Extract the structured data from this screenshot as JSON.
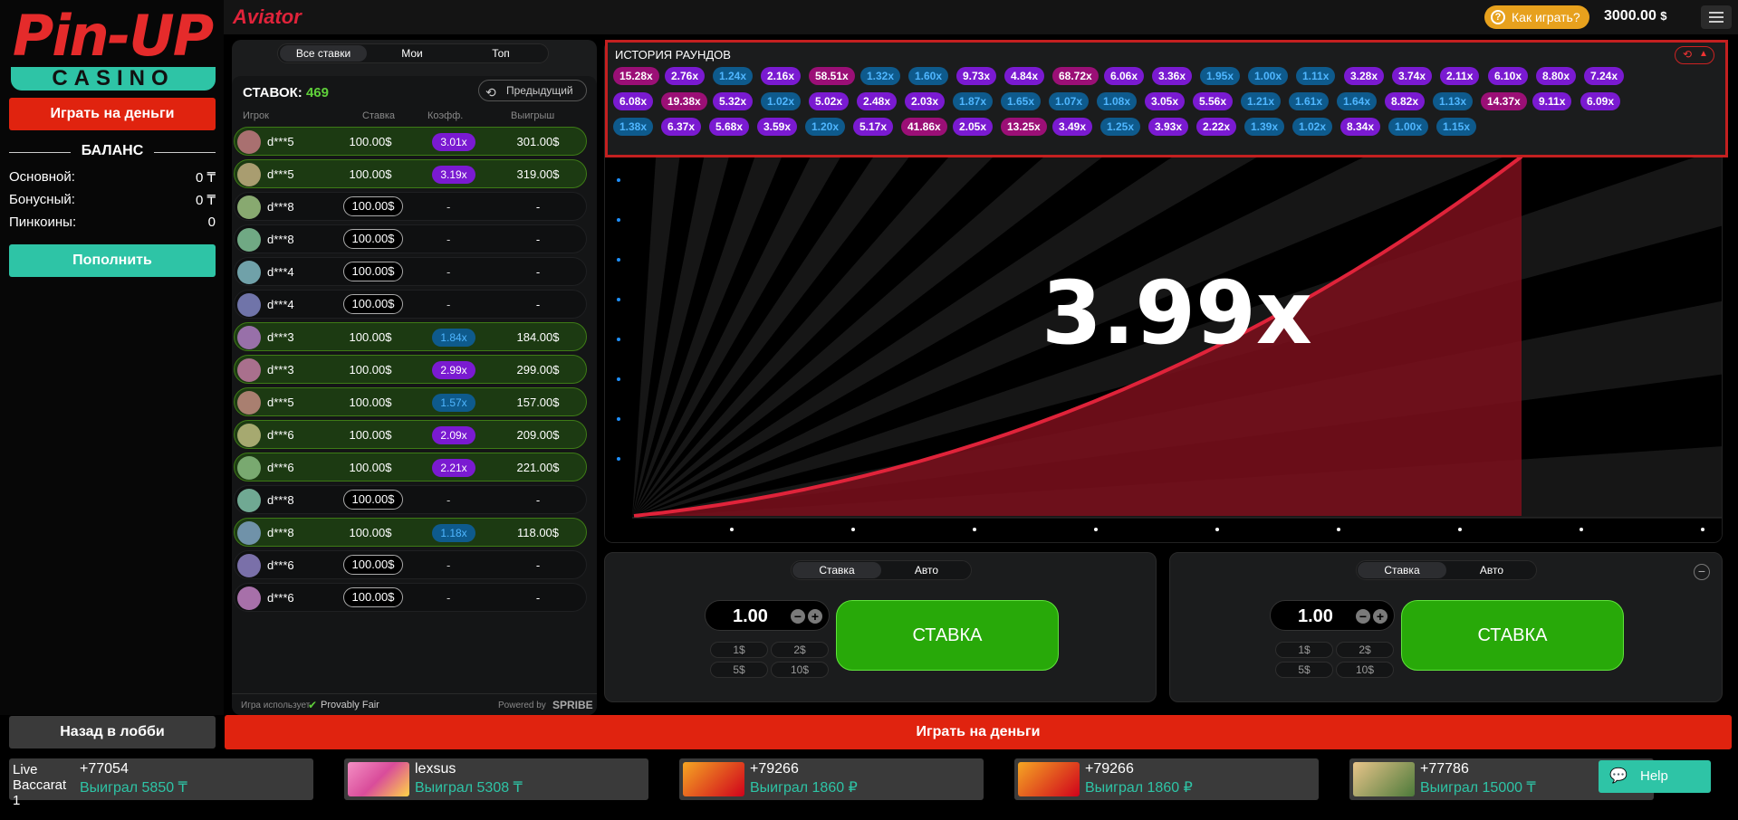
{
  "sidebar": {
    "logo_top": "Pin-UP",
    "logo_bottom": "CASINO",
    "play_money_label": "Играть на деньги",
    "balance_title": "БАЛАНС",
    "balances": [
      {
        "label": "Основной:",
        "value": "0 ₸"
      },
      {
        "label": "Бонусный:",
        "value": "0 ₸"
      },
      {
        "label": "Пинкоины:",
        "value": "0"
      }
    ],
    "deposit_label": "Пополнить",
    "lobby_label": "Назад в лобби"
  },
  "header": {
    "game_title": "Aviator",
    "how_to_label": "Как играть?",
    "balance": "3000.00",
    "currency": "$"
  },
  "bets": {
    "tabs": [
      "Все ставки",
      "Мои",
      "Топ"
    ],
    "count_label": "СТАВОК:",
    "count": "469",
    "prev_label": "Предыдущий",
    "columns": [
      "Игрок",
      "Ставка",
      "Коэфф.",
      "Выигрыш"
    ],
    "rows": [
      {
        "user": "d***5",
        "stake": "100.00$",
        "coef": "3.01x",
        "coef_color": "purp",
        "payout": "301.00$",
        "win": true
      },
      {
        "user": "d***5",
        "stake": "100.00$",
        "coef": "3.19x",
        "coef_color": "purp",
        "payout": "319.00$",
        "win": true
      },
      {
        "user": "d***8",
        "stake": "100.00$",
        "coef": "-",
        "coef_color": "",
        "payout": "-",
        "win": false
      },
      {
        "user": "d***8",
        "stake": "100.00$",
        "coef": "-",
        "coef_color": "",
        "payout": "-",
        "win": false
      },
      {
        "user": "d***4",
        "stake": "100.00$",
        "coef": "-",
        "coef_color": "",
        "payout": "-",
        "win": false
      },
      {
        "user": "d***4",
        "stake": "100.00$",
        "coef": "-",
        "coef_color": "",
        "payout": "-",
        "win": false
      },
      {
        "user": "d***3",
        "stake": "100.00$",
        "coef": "1.84x",
        "coef_color": "blue",
        "payout": "184.00$",
        "win": true
      },
      {
        "user": "d***3",
        "stake": "100.00$",
        "coef": "2.99x",
        "coef_color": "purp",
        "payout": "299.00$",
        "win": true
      },
      {
        "user": "d***5",
        "stake": "100.00$",
        "coef": "1.57x",
        "coef_color": "blue",
        "payout": "157.00$",
        "win": true
      },
      {
        "user": "d***6",
        "stake": "100.00$",
        "coef": "2.09x",
        "coef_color": "purp",
        "payout": "209.00$",
        "win": true
      },
      {
        "user": "d***6",
        "stake": "100.00$",
        "coef": "2.21x",
        "coef_color": "purp",
        "payout": "221.00$",
        "win": true
      },
      {
        "user": "d***8",
        "stake": "100.00$",
        "coef": "-",
        "coef_color": "",
        "payout": "-",
        "win": false
      },
      {
        "user": "d***8",
        "stake": "100.00$",
        "coef": "1.18x",
        "coef_color": "blue",
        "payout": "118.00$",
        "win": true
      },
      {
        "user": "d***6",
        "stake": "100.00$",
        "coef": "-",
        "coef_color": "",
        "payout": "-",
        "win": false
      },
      {
        "user": "d***6",
        "stake": "100.00$",
        "coef": "-",
        "coef_color": "",
        "payout": "-",
        "win": false
      }
    ],
    "footer_uses": "Игра использует",
    "footer_fair": "Provably Fair",
    "footer_powered": "Powered by",
    "footer_brand": "SPRIBE"
  },
  "history": {
    "title": "ИСТОРИЯ РАУНДОВ",
    "rows": [
      [
        {
          "v": "15.28x",
          "c": "pink"
        },
        {
          "v": "2.76x",
          "c": "purp"
        },
        {
          "v": "1.24x",
          "c": "blue"
        },
        {
          "v": "2.16x",
          "c": "purp"
        },
        {
          "v": "58.51x",
          "c": "pink"
        },
        {
          "v": "1.32x",
          "c": "blue"
        },
        {
          "v": "1.60x",
          "c": "blue"
        },
        {
          "v": "9.73x",
          "c": "purp"
        },
        {
          "v": "4.84x",
          "c": "purp"
        },
        {
          "v": "68.72x",
          "c": "pink"
        },
        {
          "v": "6.06x",
          "c": "purp"
        },
        {
          "v": "3.36x",
          "c": "purp"
        },
        {
          "v": "1.95x",
          "c": "blue"
        },
        {
          "v": "1.00x",
          "c": "blue"
        },
        {
          "v": "1.11x",
          "c": "blue"
        },
        {
          "v": "3.28x",
          "c": "purp"
        },
        {
          "v": "3.74x",
          "c": "purp"
        },
        {
          "v": "2.11x",
          "c": "purp"
        },
        {
          "v": "6.10x",
          "c": "purp"
        },
        {
          "v": "8.80x",
          "c": "purp"
        },
        {
          "v": "7.24x",
          "c": "purp"
        }
      ],
      [
        {
          "v": "6.08x",
          "c": "purp"
        },
        {
          "v": "19.38x",
          "c": "pink"
        },
        {
          "v": "5.32x",
          "c": "purp"
        },
        {
          "v": "1.02x",
          "c": "blue"
        },
        {
          "v": "5.02x",
          "c": "purp"
        },
        {
          "v": "2.48x",
          "c": "purp"
        },
        {
          "v": "2.03x",
          "c": "purp"
        },
        {
          "v": "1.87x",
          "c": "blue"
        },
        {
          "v": "1.65x",
          "c": "blue"
        },
        {
          "v": "1.07x",
          "c": "blue"
        },
        {
          "v": "1.08x",
          "c": "blue"
        },
        {
          "v": "3.05x",
          "c": "purp"
        },
        {
          "v": "5.56x",
          "c": "purp"
        },
        {
          "v": "1.21x",
          "c": "blue"
        },
        {
          "v": "1.61x",
          "c": "blue"
        },
        {
          "v": "1.64x",
          "c": "blue"
        },
        {
          "v": "8.82x",
          "c": "purp"
        },
        {
          "v": "1.13x",
          "c": "blue"
        },
        {
          "v": "14.37x",
          "c": "pink"
        },
        {
          "v": "9.11x",
          "c": "purp"
        },
        {
          "v": "6.09x",
          "c": "purp"
        }
      ],
      [
        {
          "v": "1.38x",
          "c": "blue"
        },
        {
          "v": "6.37x",
          "c": "purp"
        },
        {
          "v": "5.68x",
          "c": "purp"
        },
        {
          "v": "3.59x",
          "c": "purp"
        },
        {
          "v": "1.20x",
          "c": "blue"
        },
        {
          "v": "5.17x",
          "c": "purp"
        },
        {
          "v": "41.86x",
          "c": "pink"
        },
        {
          "v": "2.05x",
          "c": "purp"
        },
        {
          "v": "13.25x",
          "c": "pink"
        },
        {
          "v": "3.49x",
          "c": "purp"
        },
        {
          "v": "1.25x",
          "c": "blue"
        },
        {
          "v": "3.93x",
          "c": "purp"
        },
        {
          "v": "2.22x",
          "c": "purp"
        },
        {
          "v": "1.39x",
          "c": "blue"
        },
        {
          "v": "1.02x",
          "c": "blue"
        },
        {
          "v": "8.34x",
          "c": "purp"
        },
        {
          "v": "1.00x",
          "c": "blue"
        },
        {
          "v": "1.15x",
          "c": "blue"
        }
      ]
    ]
  },
  "game": {
    "multiplier": "3.99x"
  },
  "bet_controls": [
    {
      "tab_bet": "Ставка",
      "tab_auto": "Авто",
      "amount": "1.00",
      "quick": [
        "1$",
        "2$",
        "5$",
        "10$"
      ],
      "button": "СТАВКА"
    },
    {
      "tab_bet": "Ставка",
      "tab_auto": "Авто",
      "amount": "1.00",
      "quick": [
        "1$",
        "2$",
        "5$",
        "10$"
      ],
      "button": "СТАВКА"
    }
  ],
  "bottom": {
    "play_money_label": "Играть на деньги",
    "help_label": "Help",
    "tickers": [
      {
        "game": "Live Baccarat 1",
        "user": "+77054",
        "won": "Выиграл 5850 ₸"
      },
      {
        "game": "",
        "user": "lexsus",
        "won": "Выиграл 5308 ₸"
      },
      {
        "game": "",
        "user": "+79266",
        "won": "Выиграл 1860 ₽"
      },
      {
        "game": "",
        "user": "+79266",
        "won": "Выиграл 1860 ₽"
      },
      {
        "game": "",
        "user": "+77786",
        "won": "Выиграл 15000 ₸"
      }
    ]
  },
  "colors": {
    "red": "#e0230f",
    "teal": "#2ec4a6",
    "green": "#28a909",
    "curve": "#e0233a"
  }
}
